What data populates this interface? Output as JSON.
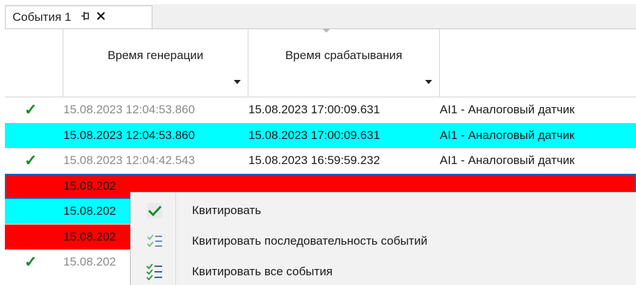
{
  "tab": {
    "title": "События 1",
    "pin_glyph": "⊣",
    "close_glyph": "✕"
  },
  "columns": [
    {
      "label": "Время генерации"
    },
    {
      "label": "Время срабатывания"
    },
    {
      "label": ""
    }
  ],
  "rows": [
    {
      "style": "ack",
      "check": "✓",
      "gen": "15.08.2023 12:04:53.860",
      "trig": "15.08.2023 17:00:09.631",
      "text": "AI1 - Аналоговый датчик"
    },
    {
      "style": "cyan",
      "check": "",
      "gen": "15.08.2023 12:04:53.860",
      "trig": "15.08.2023 17:00:09.631",
      "text": "AI1 - Аналоговый датчик"
    },
    {
      "style": "ack",
      "check": "✓",
      "gen": "15.08.2023 12:04:42.543",
      "trig": "15.08.2023 16:59:59.232",
      "text": "AI1 - Аналоговый датчик"
    },
    {
      "style": "red",
      "check": "",
      "gen": "15.08.202",
      "trig": "",
      "text": ""
    },
    {
      "style": "cyan",
      "check": "",
      "gen": "15.08.202",
      "trig": "",
      "text": ""
    },
    {
      "style": "red",
      "check": "",
      "gen": "15.08.202",
      "trig": "",
      "text": ""
    },
    {
      "style": "ack",
      "check": "✓",
      "gen": "15.08.202",
      "trig": "",
      "text": ""
    }
  ],
  "context_menu": [
    {
      "label": "Квитировать",
      "icon": "check-icon"
    },
    {
      "label": "Квитировать последовательность событий",
      "icon": "checklist-icon"
    },
    {
      "label": "Квитировать все события",
      "icon": "checklist-all-icon"
    }
  ],
  "colors": {
    "ack_check": "#0a8f22",
    "cyan_row": "#00ffff",
    "red_row": "#ff0000",
    "selection": "#1f5fbf"
  }
}
